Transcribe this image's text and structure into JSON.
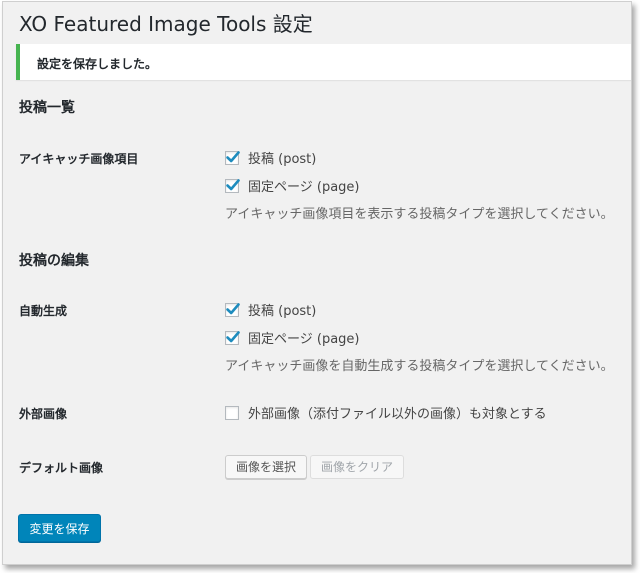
{
  "page": {
    "title": "XO Featured Image Tools 設定"
  },
  "notice": {
    "text": "設定を保存しました。",
    "color": "#46b450"
  },
  "sections": {
    "list": {
      "heading": "投稿一覧",
      "eyecatch": {
        "label": "アイキャッチ画像項目",
        "options": [
          {
            "label": "投稿 (post)",
            "checked": true
          },
          {
            "label": "固定ページ (page)",
            "checked": true
          }
        ],
        "description": "アイキャッチ画像項目を表示する投稿タイプを選択してください。"
      }
    },
    "edit": {
      "heading": "投稿の編集",
      "autogen": {
        "label": "自動生成",
        "options": [
          {
            "label": "投稿 (post)",
            "checked": true
          },
          {
            "label": "固定ページ (page)",
            "checked": true
          }
        ],
        "description": "アイキャッチ画像を自動生成する投稿タイプを選択してください。"
      },
      "external": {
        "label": "外部画像",
        "option": {
          "label": "外部画像（添付ファイル以外の画像）も対象とする",
          "checked": false
        }
      },
      "default_image": {
        "label": "デフォルト画像",
        "select_button": "画像を選択",
        "clear_button": "画像をクリア"
      }
    }
  },
  "save_button": "変更を保存",
  "colors": {
    "accent": "#0085ba",
    "check": "#1e8cbe"
  },
  "icons": {
    "checkbox_checked": "check-icon"
  }
}
